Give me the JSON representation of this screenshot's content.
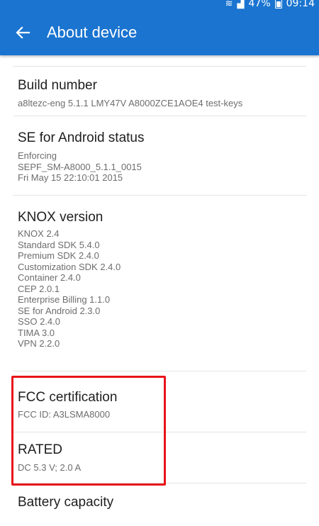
{
  "status_bar": {
    "battery_text": "47%",
    "time": "09:14"
  },
  "app_bar": {
    "title": "About device",
    "back_icon": "back-arrow-icon"
  },
  "highlight_color": "#e8141a",
  "accent_color": "#1a74d0",
  "items": [
    {
      "title": "Build number",
      "lines": [
        "a8ltezc-eng 5.1.1 LMY47V A8000ZCE1AOE4 test-keys"
      ]
    },
    {
      "title": "SE for Android status",
      "lines": [
        "Enforcing",
        "SEPF_SM-A8000_5.1.1_0015",
        "Fri May 15 22:10:01 2015"
      ]
    },
    {
      "title": "KNOX version",
      "lines": [
        "KNOX 2.4",
        "Standard SDK 5.4.0",
        "Premium SDK 2.4.0",
        "Customization SDK 2.4.0",
        "Container 2.4.0",
        "CEP 2.0.1",
        "Enterprise Billing 1.1.0",
        "SE for Android 2.3.0",
        "SSO 2.4.0",
        "TIMA 3.0",
        "VPN 2.2.0"
      ]
    },
    {
      "title": "FCC certification",
      "lines": [
        "FCC ID: A3LSMA8000"
      ]
    },
    {
      "title": "RATED",
      "lines": [
        "DC 5.3 V; 2.0 A"
      ]
    },
    {
      "title": "Battery capacity",
      "lines": []
    }
  ]
}
